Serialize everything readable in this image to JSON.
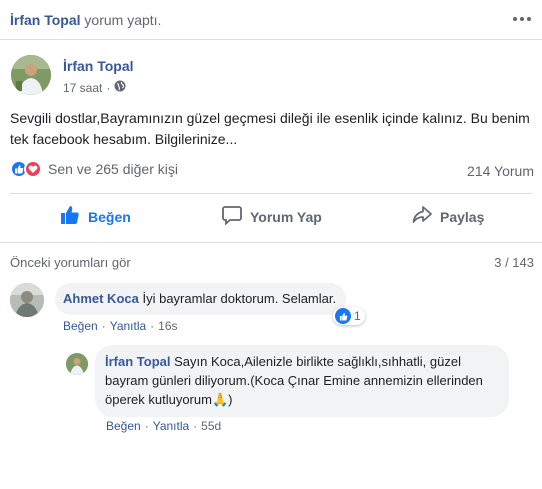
{
  "header": {
    "actor": "İrfan Topal",
    "action": "yorum yaptı."
  },
  "post": {
    "author": "İrfan Topal",
    "time": "17 saat",
    "privacy_icon": "globe-icon",
    "text": "Sevgili dostlar,Bayramınızın güzel geçmesi dileği ile esenlik içinde kalınız. Bu benim tek facebook hesabım. Bilgilerinize..."
  },
  "reactions": {
    "summary": "Sen ve 265 diğer kişi",
    "comment_count": "214 Yorum"
  },
  "actions": {
    "like": "Beğen",
    "comment": "Yorum Yap",
    "share": "Paylaş"
  },
  "comments": {
    "previous_link": "Önceki yorumları gör",
    "pager": "3 / 143",
    "items": [
      {
        "author": "Ahmet Koca",
        "text": "İyi bayramlar doktorum. Selamlar.",
        "like": "Beğen",
        "reply": "Yanıtla",
        "time": "16s",
        "reaction_count": "1"
      },
      {
        "author": "İrfan Topal",
        "text": "Sayın Koca,Ailenizle birlikte sağlıklı,sıhhatli, güzel bayram günleri diliyorum.(Koca Çınar Emine annemizin ellerinden öperek kutluyorum🙏)",
        "like": "Beğen",
        "reply": "Yanıtla",
        "time": "55d"
      }
    ]
  },
  "colors": {
    "link": "#385898",
    "like_blue": "#1877f2",
    "love_red": "#f33e58",
    "secondary_text": "#606770",
    "bubble_bg": "#f2f3f5"
  }
}
